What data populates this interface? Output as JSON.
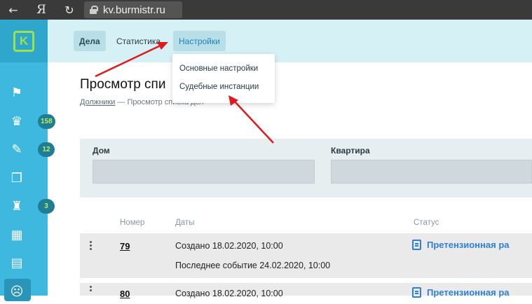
{
  "browser": {
    "back_icon": "back-arrow-icon",
    "yandex_icon": "Я",
    "reload_icon": "reload-icon",
    "url": "kv.burmistr.ru"
  },
  "sidebar": {
    "logo": "K",
    "items": [
      {
        "icon": "flag-icon",
        "glyph": "⚑",
        "badge": ""
      },
      {
        "icon": "users-icon",
        "glyph": "♛",
        "badge": "158"
      },
      {
        "icon": "edit-icon",
        "glyph": "✎",
        "badge": "12"
      },
      {
        "icon": "documents-icon",
        "glyph": "❐",
        "badge": ""
      },
      {
        "icon": "court-icon",
        "glyph": "♜",
        "badge": "3"
      },
      {
        "icon": "building-icon",
        "glyph": "▦",
        "badge": ""
      },
      {
        "icon": "calculator-icon",
        "glyph": "▤",
        "badge": ""
      },
      {
        "icon": "sad-face-icon",
        "glyph": "☹",
        "badge": ""
      }
    ]
  },
  "topnav": {
    "tabs": [
      {
        "label": "Дела"
      },
      {
        "label": "Статистика"
      },
      {
        "label": "Настройки"
      }
    ],
    "dropdown": [
      {
        "label": "Основные настройки"
      },
      {
        "label": "Судебные инстанции"
      }
    ]
  },
  "main": {
    "title": "Просмотр спи",
    "breadcrumb_link": "Должники",
    "breadcrumb_rest": " — Просмотр списка дел"
  },
  "filters": {
    "house_label": "Дом",
    "apartment_label": "Квартира"
  },
  "table": {
    "headers": [
      "Номер",
      "Даты",
      "Статус"
    ],
    "rows": [
      {
        "number": "79",
        "created": "Создано 18.02.2020, 10:00",
        "last_event": "Последнее событие 24.02.2020, 10:00",
        "status": "Претензионная ра"
      },
      {
        "number": "80",
        "created": "Создано 18.02.2020, 10:00",
        "status": "Претензионная ра"
      }
    ]
  },
  "colors": {
    "sidebar": "#3eb8de",
    "topnav": "#d6f1f6",
    "accent_blue": "#2e7fd6",
    "arrow_red": "#e0191f"
  }
}
